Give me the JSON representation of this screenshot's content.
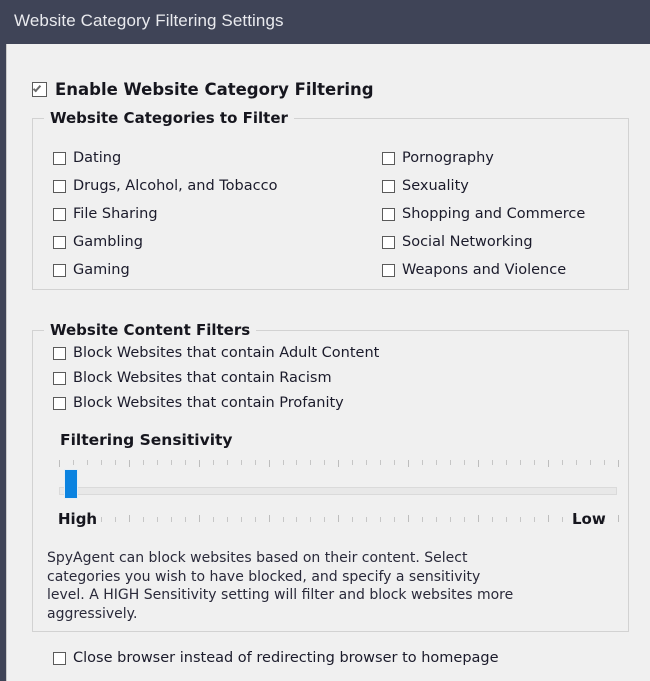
{
  "window": {
    "title": "Website Category Filtering Settings",
    "titlebar_color": "#3f4457",
    "body_color": "#f0f0f0"
  },
  "enable_filtering": {
    "label": "Enable Website Category Filtering",
    "checked": true
  },
  "categories_group": {
    "legend": "Website Categories to Filter",
    "left_column": [
      {
        "label": "Dating",
        "checked": false
      },
      {
        "label": "Drugs, Alcohol, and Tobacco",
        "checked": false
      },
      {
        "label": "File Sharing",
        "checked": false
      },
      {
        "label": "Gambling",
        "checked": false
      },
      {
        "label": "Gaming",
        "checked": false
      }
    ],
    "right_column": [
      {
        "label": "Pornography",
        "checked": false
      },
      {
        "label": "Sexuality",
        "checked": false
      },
      {
        "label": "Shopping and Commerce",
        "checked": false
      },
      {
        "label": "Social Networking",
        "checked": false
      },
      {
        "label": "Weapons and Violence",
        "checked": false
      }
    ]
  },
  "content_group": {
    "legend": "Website Content Filters",
    "checkboxes": [
      {
        "label": "Block Websites that contain Adult Content",
        "checked": false
      },
      {
        "label": "Block Websites that contain Racism",
        "checked": false
      },
      {
        "label": "Block Websites that contain Profanity",
        "checked": false
      }
    ],
    "sensitivity": {
      "title": "Filtering Sensitivity",
      "left_label": "High",
      "right_label": "Low",
      "value_position_percent": 1,
      "thumb_color": "#0b83e0",
      "tick_count": 41
    },
    "description": "SpyAgent can block websites based on their content. Select categories you wish to have blocked, and specify a sensitivity level. A HIGH Sensitivity setting will filter and block websites more aggressively."
  },
  "bottom_option": {
    "label": "Close browser instead of redirecting browser to homepage",
    "checked": false
  }
}
